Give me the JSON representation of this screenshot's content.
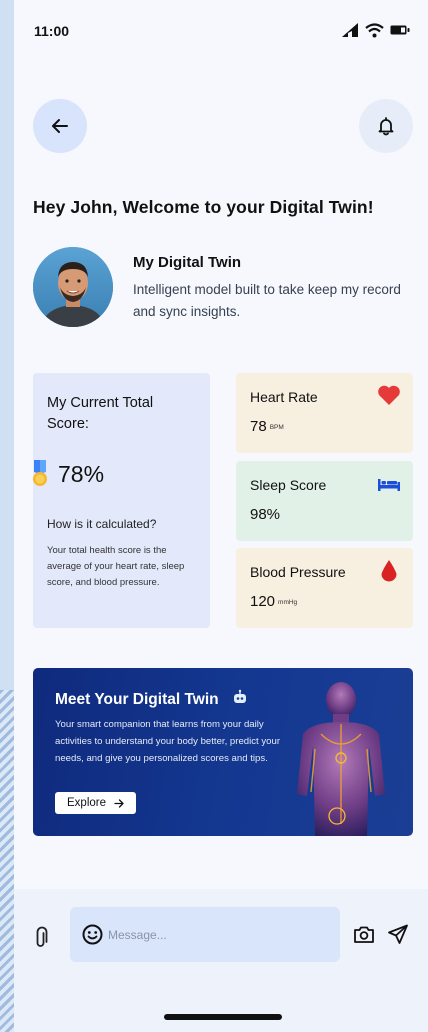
{
  "status_bar": {
    "time": "11:00"
  },
  "header": {
    "greeting": "Hey John, Welcome to your Digital Twin!"
  },
  "profile": {
    "title": "My Digital Twin",
    "description": "Intelligent model built to take keep my record and sync insights."
  },
  "score": {
    "title": "My Current Total Score:",
    "value": "78%",
    "how_title": "How is it calculated?",
    "how_description": "Your total health score is the average of your heart rate, sleep score, and blood pressure."
  },
  "metrics": {
    "heart_rate": {
      "label": "Heart Rate",
      "value": "78",
      "unit": "BPM",
      "icon": "heart-icon"
    },
    "sleep_score": {
      "label": "Sleep Score",
      "value": "98%",
      "icon": "bed-icon"
    },
    "blood_pressure": {
      "label": "Blood Pressure",
      "value": "120",
      "unit": "mmHg",
      "icon": "blood-drop-icon"
    }
  },
  "banner": {
    "title": "Meet Your Digital Twin",
    "description": "Your smart companion that learns from your daily activities to understand your body better, predict your needs, and give you personalized scores and tips.",
    "button_label": "Explore"
  },
  "composer": {
    "placeholder": "Message..."
  },
  "colors": {
    "accent_blue": "#d7e4fb",
    "banner_navy": "#143891",
    "heart_red": "#e63a3a",
    "sleep_blue": "#1d4ed8"
  }
}
